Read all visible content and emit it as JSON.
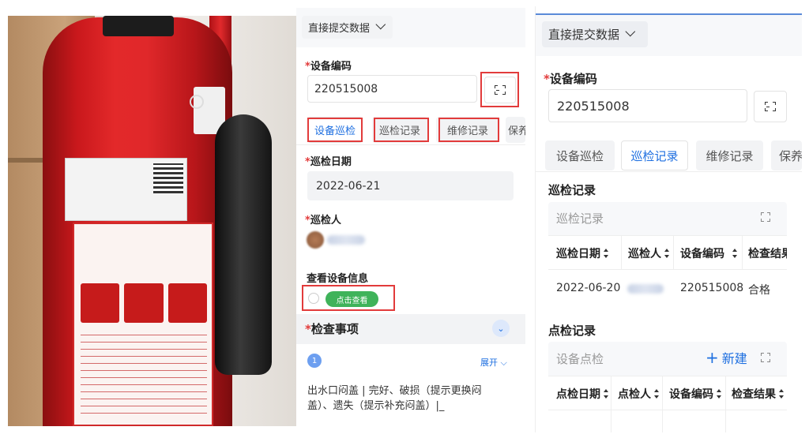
{
  "colors": {
    "accent": "#1e6fe0",
    "required": "#e23b3b",
    "success": "#3fb35a",
    "highlight": "#e23b3b"
  },
  "left": {
    "submit_mode": "直接提交数据",
    "device_code": {
      "label": "设备编码",
      "value": "220515008"
    },
    "tabs": [
      {
        "label": "设备巡检",
        "active": true
      },
      {
        "label": "巡检记录",
        "active": false
      },
      {
        "label": "维修记录",
        "active": false
      },
      {
        "label": "保养",
        "active": false
      }
    ],
    "inspect_date": {
      "label": "巡检日期",
      "value": "2022-06-21"
    },
    "inspector": {
      "label": "巡检人"
    },
    "view_device": {
      "label": "查看设备信息",
      "button": "点击查看"
    },
    "check_items": {
      "label": "检查事项",
      "badge": "1",
      "expand": "展开",
      "text": "出水口闷盖 | 完好、破损（提示更换闷盖）、遗失（提示补充闷盖）|_"
    }
  },
  "right": {
    "submit_mode": "直接提交数据",
    "device_code": {
      "label": "设备编码",
      "value": "220515008"
    },
    "tabs": [
      {
        "label": "设备巡检",
        "active": false
      },
      {
        "label": "巡检记录",
        "active": true
      },
      {
        "label": "维修记录",
        "active": false
      },
      {
        "label": "保养",
        "active": false
      }
    ],
    "inspection_section": {
      "title": "巡检记录",
      "card_title": "巡检记录",
      "columns": [
        "巡检日期",
        "巡检人",
        "设备编码",
        "检查结果"
      ],
      "rows": [
        {
          "date": "2022-06-20",
          "code": "220515008",
          "result": "合格"
        }
      ]
    },
    "spot_section": {
      "title": "点检记录",
      "card_title": "设备点检",
      "new_button": "新建",
      "columns": [
        "点检日期",
        "点检人",
        "设备编码",
        "检查结果"
      ]
    }
  },
  "icons": {
    "scan": "scan-icon",
    "chevron": "chevron-down-icon",
    "expand": "fullscreen-icon",
    "plus": "plus-icon",
    "double_chevron": "double-chevron-down-icon"
  }
}
